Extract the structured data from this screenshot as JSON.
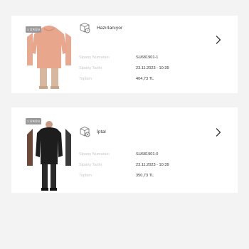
{
  "orders": [
    {
      "badge": "1 ÜRÜN",
      "status": "Hazırlanıyor",
      "labels": [
        "Sipariş Numarası",
        "Sipariş Tarihi",
        "Toplam"
      ],
      "order_number": "SU681901-1",
      "order_date": "23.11.2023 - 10:39",
      "total": "404,73 TL",
      "product_color": "#e8a68d"
    },
    {
      "badge": "1 ÜRÜN",
      "status": "İptal",
      "labels": [
        "Sipariş Numarası",
        "Sipariş Tarihi",
        "Toplam"
      ],
      "order_number": "SU681901-0",
      "order_date": "23.11.2023 - 10:39",
      "total": "350,73 TL",
      "product_color": "#1d1d1d"
    }
  ],
  "icons": {
    "status": "package-status-icon",
    "chevron": "chevron-right-icon"
  },
  "colors": {
    "background": "#f3f3f3",
    "card": "#ffffff",
    "label": "#c8c8c8",
    "badge": "#9a9a9a"
  }
}
